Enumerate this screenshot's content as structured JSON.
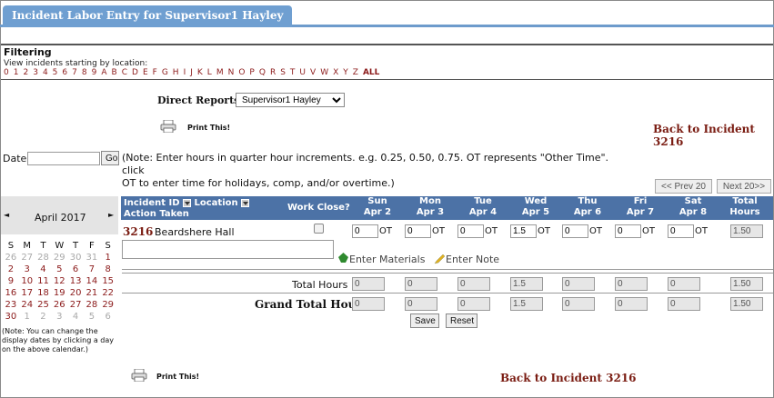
{
  "tab": {
    "title": "Incident Labor Entry for Supervisor1 Hayley"
  },
  "filter": {
    "title": "Filtering",
    "subtitle": "View incidents starting by location:",
    "letters": [
      "0",
      "1",
      "2",
      "3",
      "4",
      "5",
      "6",
      "7",
      "8",
      "9",
      "A",
      "B",
      "C",
      "D",
      "E",
      "F",
      "G",
      "H",
      "I",
      "J",
      "K",
      "L",
      "M",
      "N",
      "O",
      "P",
      "Q",
      "R",
      "S",
      "T",
      "U",
      "V",
      "W",
      "X",
      "Y",
      "Z"
    ],
    "all": "ALL"
  },
  "direct_reports": {
    "label": "Direct Reports",
    "value": "Supervisor1 Hayley"
  },
  "print_label": "Print This!",
  "back_label": "Back to Incident 3216",
  "date": {
    "label": "Date",
    "value": "",
    "go": "Go"
  },
  "note": {
    "line1": "(Note: Enter hours in quarter hour increments. e.g. 0.25, 0.50, 0.75. OT represents \"Other Time\". click",
    "line2": "OT to enter time for holidays, comp, and/or overtime.)"
  },
  "pager": {
    "prev": "<< Prev 20",
    "next": "Next 20>>"
  },
  "calendar": {
    "month": "April 2017",
    "prev": "◄",
    "next": "►",
    "weekdays": [
      "S",
      "M",
      "T",
      "W",
      "T",
      "F",
      "S"
    ],
    "weeks": [
      [
        "26",
        "27",
        "28",
        "29",
        "30",
        "31",
        "1"
      ],
      [
        "2",
        "3",
        "4",
        "5",
        "6",
        "7",
        "8"
      ],
      [
        "9",
        "10",
        "11",
        "12",
        "13",
        "14",
        "15"
      ],
      [
        "16",
        "17",
        "18",
        "19",
        "20",
        "21",
        "22"
      ],
      [
        "23",
        "24",
        "25",
        "26",
        "27",
        "28",
        "29"
      ],
      [
        "30",
        "1",
        "2",
        "3",
        "4",
        "5",
        "6"
      ]
    ],
    "note_lines": [
      "(Note: You can change the",
      "display dates by clicking a day",
      "on the above calendar.)"
    ]
  },
  "table": {
    "col_incident": "Incident ID",
    "col_location": "Location",
    "col_action": "Action Taken",
    "col_work_close": "Work Close?",
    "days": [
      {
        "day": "Sun",
        "date": "Apr 2"
      },
      {
        "day": "Mon",
        "date": "Apr 3"
      },
      {
        "day": "Tue",
        "date": "Apr 4"
      },
      {
        "day": "Wed",
        "date": "Apr 5"
      },
      {
        "day": "Thu",
        "date": "Apr 6"
      },
      {
        "day": "Fri",
        "date": "Apr 7"
      },
      {
        "day": "Sat",
        "date": "Apr 8"
      }
    ],
    "col_total": "Total Hours",
    "row": {
      "incident_id": "3216",
      "location": "Beardshere Hall",
      "hours": [
        "0",
        "0",
        "0",
        "1.5",
        "0",
        "0",
        "0"
      ],
      "ot": "OT",
      "total": "1.50",
      "enter_materials": "Enter Materials",
      "enter_note": "Enter Note"
    },
    "totals_label": "Total Hours",
    "totals": [
      "0",
      "0",
      "0",
      "1.5",
      "0",
      "0",
      "0"
    ],
    "totals_sum": "1.50",
    "grand_label": "Grand Total Hours",
    "grand": [
      "0",
      "0",
      "0",
      "1.5",
      "0",
      "0",
      "0"
    ],
    "grand_sum": "1.50"
  },
  "buttons": {
    "save": "Save",
    "reset": "Reset"
  },
  "colors": {
    "tab": "#6f9fd1",
    "header": "#4c72a6",
    "maroon": "#7a1c12"
  }
}
